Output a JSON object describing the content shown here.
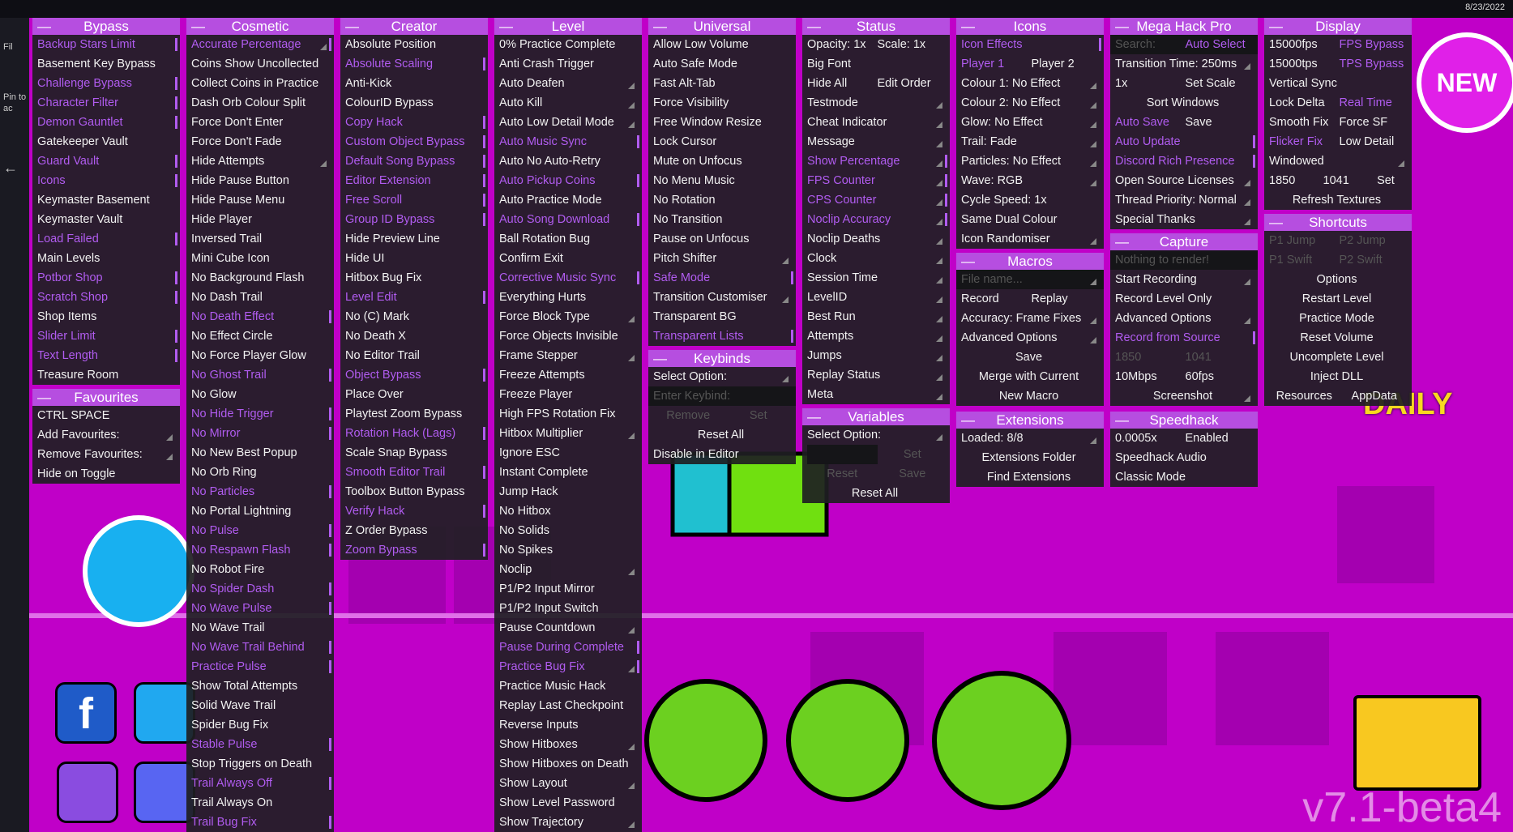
{
  "date": "8/23/2022",
  "watermark": "v7.1-beta4",
  "new_badge": "NEW",
  "daily_badge": "DAILY",
  "left_strip": [
    "Fil",
    "Pin to",
    "ac"
  ],
  "panels": {
    "bypass": {
      "title": "Bypass",
      "items": [
        {
          "label": "Backup Stars Limit",
          "on": true
        },
        {
          "label": "Basement Key Bypass"
        },
        {
          "label": "Challenge Bypass",
          "on": true
        },
        {
          "label": "Character Filter",
          "on": true
        },
        {
          "label": "Demon Gauntlet",
          "on": true
        },
        {
          "label": "Gatekeeper Vault"
        },
        {
          "label": "Guard Vault",
          "on": true
        },
        {
          "label": "Icons",
          "on": true
        },
        {
          "label": "Keymaster Basement"
        },
        {
          "label": "Keymaster Vault"
        },
        {
          "label": "Load Failed",
          "on": true
        },
        {
          "label": "Main Levels"
        },
        {
          "label": "Potbor Shop",
          "on": true
        },
        {
          "label": "Scratch Shop",
          "on": true
        },
        {
          "label": "Shop Items"
        },
        {
          "label": "Slider Limit",
          "on": true
        },
        {
          "label": "Text Length",
          "on": true
        },
        {
          "label": "Treasure Room"
        }
      ]
    },
    "favourites": {
      "title": "Favourites",
      "items": [
        {
          "label": "CTRL SPACE"
        },
        {
          "label": "Add Favourites:",
          "arr": true
        },
        {
          "label": "Remove Favourites:",
          "arr": true
        },
        {
          "label": "Hide on Toggle"
        }
      ]
    },
    "cosmetic": {
      "title": "Cosmetic",
      "items": [
        {
          "label": "Accurate Percentage",
          "on": true,
          "arr": true
        },
        {
          "label": "Coins Show Uncollected"
        },
        {
          "label": "Collect Coins in Practice"
        },
        {
          "label": "Dash Orb Colour Split"
        },
        {
          "label": "Force Don't Enter"
        },
        {
          "label": "Force Don't Fade"
        },
        {
          "label": "Hide Attempts",
          "arr": true
        },
        {
          "label": "Hide Pause Button"
        },
        {
          "label": "Hide Pause Menu"
        },
        {
          "label": "Hide Player"
        },
        {
          "label": "Inversed Trail"
        },
        {
          "label": "Mini Cube Icon"
        },
        {
          "label": "No Background Flash"
        },
        {
          "label": "No Dash Trail"
        },
        {
          "label": "No Death Effect",
          "on": true
        },
        {
          "label": "No Effect Circle"
        },
        {
          "label": "No Force Player Glow"
        },
        {
          "label": "No Ghost Trail",
          "on": true
        },
        {
          "label": "No Glow"
        },
        {
          "label": "No Hide Trigger",
          "on": true
        },
        {
          "label": "No Mirror",
          "on": true
        },
        {
          "label": "No New Best Popup"
        },
        {
          "label": "No Orb Ring"
        },
        {
          "label": "No Particles",
          "on": true
        },
        {
          "label": "No Portal Lightning"
        },
        {
          "label": "No Pulse",
          "on": true
        },
        {
          "label": "No Respawn Flash",
          "on": true
        },
        {
          "label": "No Robot Fire"
        },
        {
          "label": "No Spider Dash",
          "on": true
        },
        {
          "label": "No Wave Pulse",
          "on": true
        },
        {
          "label": "No Wave Trail"
        },
        {
          "label": "No Wave Trail Behind",
          "on": true
        },
        {
          "label": "Practice Pulse",
          "on": true
        },
        {
          "label": "Show Total Attempts"
        },
        {
          "label": "Solid Wave Trail"
        },
        {
          "label": "Spider Bug Fix"
        },
        {
          "label": "Stable Pulse",
          "on": true
        },
        {
          "label": "Stop Triggers on Death"
        },
        {
          "label": "Trail Always Off",
          "on": true
        },
        {
          "label": "Trail Always On"
        },
        {
          "label": "Trail Bug Fix",
          "on": true
        }
      ]
    },
    "creator": {
      "title": "Creator",
      "items": [
        {
          "label": "Absolute Position"
        },
        {
          "label": "Absolute Scaling",
          "on": true
        },
        {
          "label": "Anti-Kick"
        },
        {
          "label": "ColourID Bypass"
        },
        {
          "label": "Copy Hack",
          "on": true
        },
        {
          "label": "Custom Object Bypass",
          "on": true
        },
        {
          "label": "Default Song Bypass",
          "on": true
        },
        {
          "label": "Editor Extension",
          "on": true
        },
        {
          "label": "Free Scroll",
          "on": true
        },
        {
          "label": "Group ID Bypass",
          "on": true
        },
        {
          "label": "Hide Preview Line"
        },
        {
          "label": "Hide UI"
        },
        {
          "label": "Hitbox Bug Fix"
        },
        {
          "label": "Level Edit",
          "on": true
        },
        {
          "label": "No (C) Mark"
        },
        {
          "label": "No Death X"
        },
        {
          "label": "No Editor Trail"
        },
        {
          "label": "Object Bypass",
          "on": true
        },
        {
          "label": "Place Over"
        },
        {
          "label": "Playtest Zoom Bypass"
        },
        {
          "label": "Rotation Hack (Lags)",
          "on": true
        },
        {
          "label": "Scale Snap Bypass"
        },
        {
          "label": "Smooth Editor Trail",
          "on": true
        },
        {
          "label": "Toolbox Button Bypass"
        },
        {
          "label": "Verify Hack",
          "on": true
        },
        {
          "label": "Z Order Bypass"
        },
        {
          "label": "Zoom Bypass",
          "on": true
        }
      ]
    },
    "level": {
      "title": "Level",
      "items": [
        {
          "label": "0% Practice Complete"
        },
        {
          "label": "Anti Crash Trigger"
        },
        {
          "label": "Auto Deafen",
          "arr": true
        },
        {
          "label": "Auto Kill",
          "arr": true
        },
        {
          "label": "Auto Low Detail Mode",
          "arr": true
        },
        {
          "label": "Auto Music Sync",
          "on": true
        },
        {
          "label": "Auto No Auto-Retry"
        },
        {
          "label": "Auto Pickup Coins",
          "on": true
        },
        {
          "label": "Auto Practice Mode"
        },
        {
          "label": "Auto Song Download",
          "on": true
        },
        {
          "label": "Ball Rotation Bug"
        },
        {
          "label": "Confirm Exit"
        },
        {
          "label": "Corrective Music Sync",
          "on": true
        },
        {
          "label": "Everything Hurts"
        },
        {
          "label": "Force Block Type",
          "arr": true
        },
        {
          "label": "Force Objects Invisible"
        },
        {
          "label": "Frame Stepper",
          "arr": true
        },
        {
          "label": "Freeze Attempts"
        },
        {
          "label": "Freeze Player"
        },
        {
          "label": "High FPS Rotation Fix"
        },
        {
          "label": "Hitbox Multiplier",
          "arr": true
        },
        {
          "label": "Ignore ESC"
        },
        {
          "label": "Instant Complete"
        },
        {
          "label": "Jump Hack"
        },
        {
          "label": "No Hitbox"
        },
        {
          "label": "No Solids"
        },
        {
          "label": "No Spikes"
        },
        {
          "label": "Noclip",
          "arr": true
        },
        {
          "label": "P1/P2 Input Mirror"
        },
        {
          "label": "P1/P2 Input Switch"
        },
        {
          "label": "Pause Countdown",
          "arr": true
        },
        {
          "label": "Pause During Complete",
          "on": true
        },
        {
          "label": "Practice Bug Fix",
          "on": true,
          "arr": true
        },
        {
          "label": "Practice Music Hack"
        },
        {
          "label": "Replay Last Checkpoint"
        },
        {
          "label": "Reverse Inputs"
        },
        {
          "label": "Show Hitboxes",
          "arr": true
        },
        {
          "label": "Show Hitboxes on Death"
        },
        {
          "label": "Show Layout",
          "arr": true
        },
        {
          "label": "Show Level Password"
        },
        {
          "label": "Show Trajectory",
          "arr": true
        }
      ]
    },
    "universal": {
      "title": "Universal",
      "items": [
        {
          "label": "Allow Low Volume"
        },
        {
          "label": "Auto Safe Mode"
        },
        {
          "label": "Fast Alt-Tab"
        },
        {
          "label": "Force Visibility"
        },
        {
          "label": "Free Window Resize"
        },
        {
          "label": "Lock Cursor"
        },
        {
          "label": "Mute on Unfocus"
        },
        {
          "label": "No Menu Music"
        },
        {
          "label": "No Rotation"
        },
        {
          "label": "No Transition"
        },
        {
          "label": "Pause on Unfocus"
        },
        {
          "label": "Pitch Shifter",
          "arr": true
        },
        {
          "label": "Safe Mode",
          "on": true
        },
        {
          "label": "Transition Customiser",
          "arr": true
        },
        {
          "label": "Transparent BG"
        },
        {
          "label": "Transparent Lists",
          "on": true
        }
      ]
    },
    "keybinds": {
      "title": "Keybinds",
      "select": "Select Option:",
      "enter_placeholder": "Enter Keybind:",
      "remove": "Remove",
      "set": "Set",
      "reset_all": "Reset All",
      "disable": "Disable in Editor"
    },
    "status": {
      "title": "Status",
      "opacity": "Opacity: 1x",
      "scale": "Scale: 1x",
      "big_font": "Big Font",
      "hide_all": "Hide All",
      "edit_order": "Edit Order",
      "items": [
        {
          "label": "Testmode",
          "arr": true
        },
        {
          "label": "Cheat Indicator",
          "arr": true
        },
        {
          "label": "Message",
          "arr": true
        },
        {
          "label": "Show Percentage",
          "on": true,
          "arr": true
        },
        {
          "label": "FPS Counter",
          "on": true,
          "arr": true
        },
        {
          "label": "CPS Counter",
          "on": true,
          "arr": true
        },
        {
          "label": "Noclip Accuracy",
          "on": true,
          "arr": true
        },
        {
          "label": "Noclip Deaths",
          "arr": true
        },
        {
          "label": "Clock",
          "arr": true
        },
        {
          "label": "Session Time",
          "arr": true
        },
        {
          "label": "LevelID",
          "arr": true
        },
        {
          "label": "Best Run",
          "arr": true
        },
        {
          "label": "Attempts",
          "arr": true
        },
        {
          "label": "Jumps",
          "arr": true
        },
        {
          "label": "Replay Status",
          "arr": true
        },
        {
          "label": "Meta",
          "arr": true
        }
      ]
    },
    "variables": {
      "title": "Variables",
      "select": "Select Option:",
      "set": "Set",
      "reset": "Reset",
      "save": "Save",
      "reset_all": "Reset All"
    },
    "icons": {
      "title": "Icons",
      "icon_effects": "Icon Effects",
      "player1": "Player 1",
      "player2": "Player 2",
      "items": [
        {
          "label": "Colour 1: No Effect",
          "arr": true
        },
        {
          "label": "Colour 2: No Effect",
          "arr": true
        },
        {
          "label": "Glow: No Effect",
          "arr": true
        },
        {
          "label": "Trail: Fade",
          "arr": true
        },
        {
          "label": "Particles: No Effect",
          "arr": true
        },
        {
          "label": "Wave: RGB",
          "arr": true
        },
        {
          "label": "Cycle Speed: 1x"
        },
        {
          "label": "Same Dual Colour"
        },
        {
          "label": "Icon Randomiser",
          "arr": true
        }
      ]
    },
    "macros": {
      "title": "Macros",
      "file_placeholder": "File name...",
      "record": "Record",
      "replay": "Replay",
      "accuracy": "Accuracy: Frame Fixes",
      "advanced": "Advanced Options",
      "save": "Save",
      "merge": "Merge with Current",
      "new_macro": "New Macro"
    },
    "extensions": {
      "title": "Extensions",
      "loaded": "Loaded: 8/8",
      "folder": "Extensions Folder",
      "find": "Find Extensions"
    },
    "megahack": {
      "title": "Mega Hack Pro",
      "search_placeholder": "Search:",
      "auto_select": "Auto Select",
      "transition": "Transition Time: 250ms",
      "scale_val": "1x",
      "set_scale": "Set Scale",
      "sort_windows": "Sort Windows",
      "auto_save": "Auto Save",
      "save": "Save",
      "items": [
        {
          "label": "Auto Update",
          "on": true
        },
        {
          "label": "Discord Rich Presence",
          "on": true
        },
        {
          "label": "Open Source Licenses",
          "arr": true
        },
        {
          "label": "Thread Priority: Normal",
          "arr": true
        },
        {
          "label": "Special Thanks",
          "arr": true
        }
      ]
    },
    "capture": {
      "title": "Capture",
      "nothing": "Nothing to render!",
      "start": "Start Recording",
      "level_only": "Record Level Only",
      "advanced": "Advanced Options",
      "from_source": "Record from Source",
      "w": "1850",
      "h": "1041",
      "bitrate": "10Mbps",
      "fps": "60fps",
      "screenshot": "Screenshot"
    },
    "speedhack": {
      "title": "Speedhack",
      "value": "0.0005x",
      "enabled": "Enabled",
      "audio": "Speedhack Audio",
      "classic": "Classic Mode"
    },
    "display": {
      "title": "Display",
      "fps_val": "15000fps",
      "fps_bypass": "FPS Bypass",
      "tps_val": "15000tps",
      "tps_bypass": "TPS Bypass",
      "vsync": "Vertical Sync",
      "lock_delta": "Lock Delta",
      "real_time": "Real Time",
      "smooth_fix": "Smooth Fix",
      "force_sf": "Force SF",
      "flicker_fix": "Flicker Fix",
      "low_detail": "Low Detail",
      "windowed": "Windowed",
      "w": "1850",
      "h": "1041",
      "set": "Set",
      "refresh": "Refresh Textures"
    },
    "shortcuts": {
      "title": "Shortcuts",
      "p1jump": "P1 Jump",
      "p2jump": "P2 Jump",
      "p1swift": "P1 Swift",
      "p2swift": "P2 Swift",
      "items": [
        {
          "label": "Options"
        },
        {
          "label": "Restart Level"
        },
        {
          "label": "Practice Mode"
        },
        {
          "label": "Reset Volume"
        },
        {
          "label": "Uncomplete Level"
        },
        {
          "label": "Inject DLL"
        }
      ],
      "resources": "Resources",
      "appdata": "AppData"
    }
  }
}
